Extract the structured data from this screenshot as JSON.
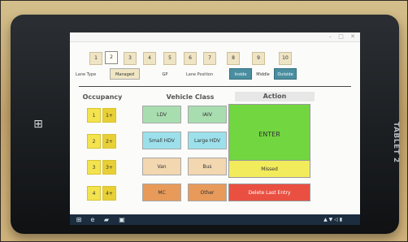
{
  "photo": {
    "tablet_brand": "TABLET 2",
    "windows_button_symbol": "⊞"
  },
  "window": {
    "title": "",
    "controls": "– □ ✕"
  },
  "lane_numbers": {
    "items": [
      "1",
      "2",
      "3",
      "4",
      "5",
      "6",
      "7",
      "8",
      "9",
      "10"
    ],
    "selected_index": 1
  },
  "lane_type": {
    "label": "Lane Type",
    "options": [
      "Managed",
      "GP"
    ],
    "selected": "Managed"
  },
  "lane_position": {
    "label": "Lane Position",
    "options": [
      "Inside",
      "Middle",
      "Outside"
    ],
    "selected": "Inside"
  },
  "occupancy": {
    "title": "Occupancy",
    "buttons": [
      "1",
      "1+",
      "2",
      "2+",
      "3",
      "3+",
      "4",
      "4+"
    ]
  },
  "vehicle_class": {
    "title": "Vehicle Class",
    "buttons": [
      "LDV",
      "IAIV",
      "Small HDV",
      "Large HDV",
      "Van",
      "Bus",
      "MC",
      "Other"
    ]
  },
  "action": {
    "title": "Action",
    "enter": "ENTER",
    "missed": "Missed",
    "delete": "Delete Last Entry"
  },
  "taskbar": {
    "icons": [
      "windows-logo",
      "internet-explorer",
      "file-explorer",
      "app-window"
    ],
    "tray_text": "▲ ▼ ◁ ▮",
    "clock_time": "",
    "clock_date": ""
  },
  "colors": {
    "selected_blue": "#4a8ea0",
    "tan": "#f0e6c4",
    "yellow": "#f3e34e",
    "green": "#a8ddb0",
    "cyan": "#9ce0eb",
    "sand": "#f2d7b0",
    "orange": "#e89a5a",
    "enter_green": "#72d640",
    "missed_yellow": "#f2ec5c",
    "delete_red": "#ea5041"
  }
}
